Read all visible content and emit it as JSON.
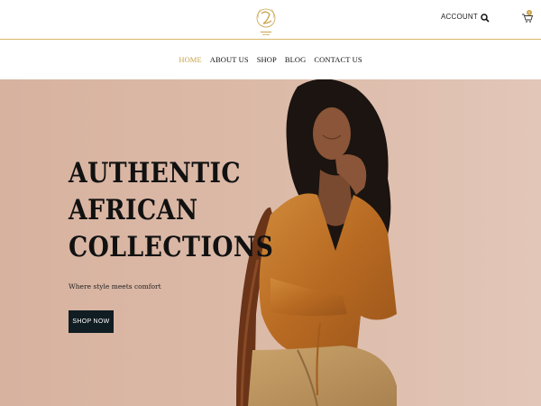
{
  "header": {
    "logo_alt": "logo",
    "account_label": "ACCOUNT",
    "cart_count": "0"
  },
  "nav": {
    "items": [
      {
        "label": "HOME",
        "active": true
      },
      {
        "label": "ABOUT US",
        "active": false
      },
      {
        "label": "SHOP",
        "active": false
      },
      {
        "label": "BLOG",
        "active": false
      },
      {
        "label": "CONTACT US",
        "active": false
      }
    ]
  },
  "hero": {
    "title_lines": [
      "AUTHENTIC",
      "AFRICAN",
      "COLLECTIONS"
    ],
    "subtitle": "Where style meets comfort",
    "cta_label": "SHOP NOW"
  },
  "colors": {
    "gold_accent": "#c8a24a",
    "hero_bg": "#d9b9a6",
    "cta_bg": "#101d22",
    "text_dark": "#111111"
  },
  "icons": {
    "search": "search-icon",
    "cart": "cart-icon",
    "logo": "monogram-logo-icon"
  }
}
